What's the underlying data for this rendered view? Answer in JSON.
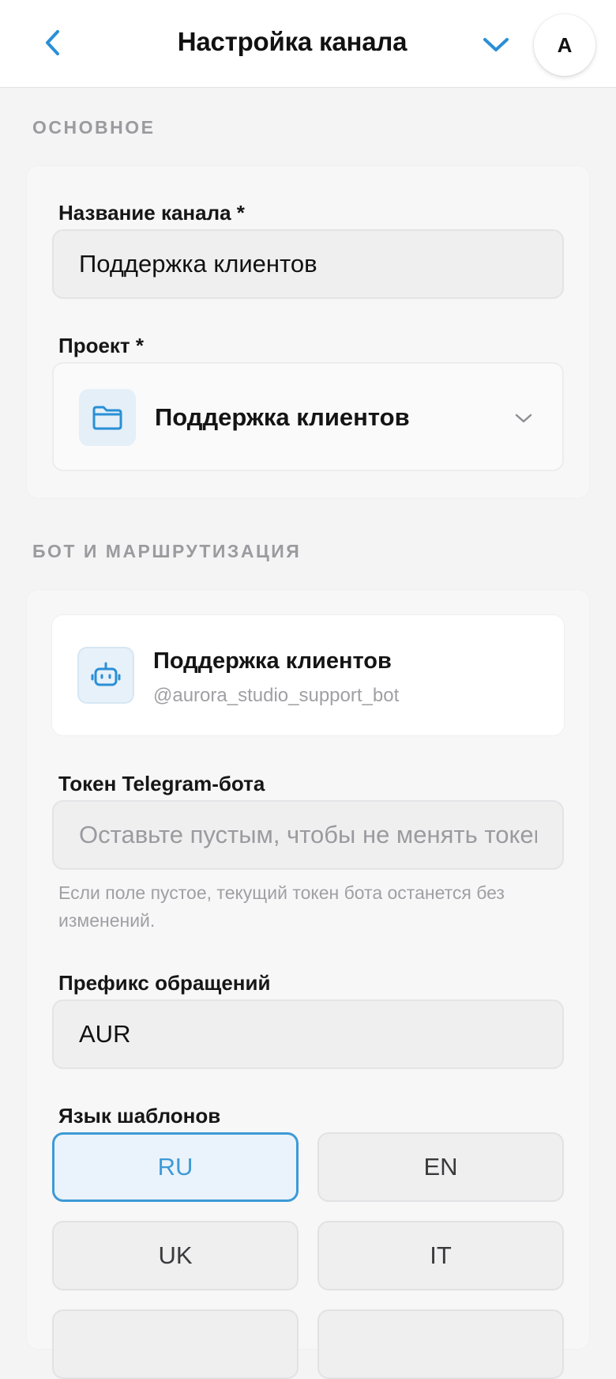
{
  "header": {
    "title": "Настройка канала",
    "avatar_initial": "A",
    "accent_color": "#2a8fd6"
  },
  "sections": {
    "general_label": "ОСНОВНОЕ",
    "bot_routing_label": "БОТ И МАРШРУТИЗАЦИЯ"
  },
  "general": {
    "channel_name_label": "Название канала *",
    "channel_name_value": "Поддержка клиентов",
    "project_label": "Проект *",
    "project_value": "Поддержка клиентов",
    "project_icon": "folder-icon"
  },
  "bot": {
    "name": "Поддержка клиентов",
    "handle": "@aurora_studio_support_bot",
    "icon": "bot-icon",
    "token_label": "Токен Telegram-бота",
    "token_placeholder": "Оставьте пустым, чтобы не менять токен",
    "token_value": "",
    "token_hint": "Если поле пустое, текущий токен бота останется без изменений.",
    "prefix_label": "Префикс обращений",
    "prefix_value": "AUR"
  },
  "templates": {
    "language_label": "Язык шаблонов",
    "selected": "RU",
    "selected_color": "#3d9ad6",
    "options": [
      "RU",
      "EN",
      "UK",
      "IT"
    ]
  }
}
